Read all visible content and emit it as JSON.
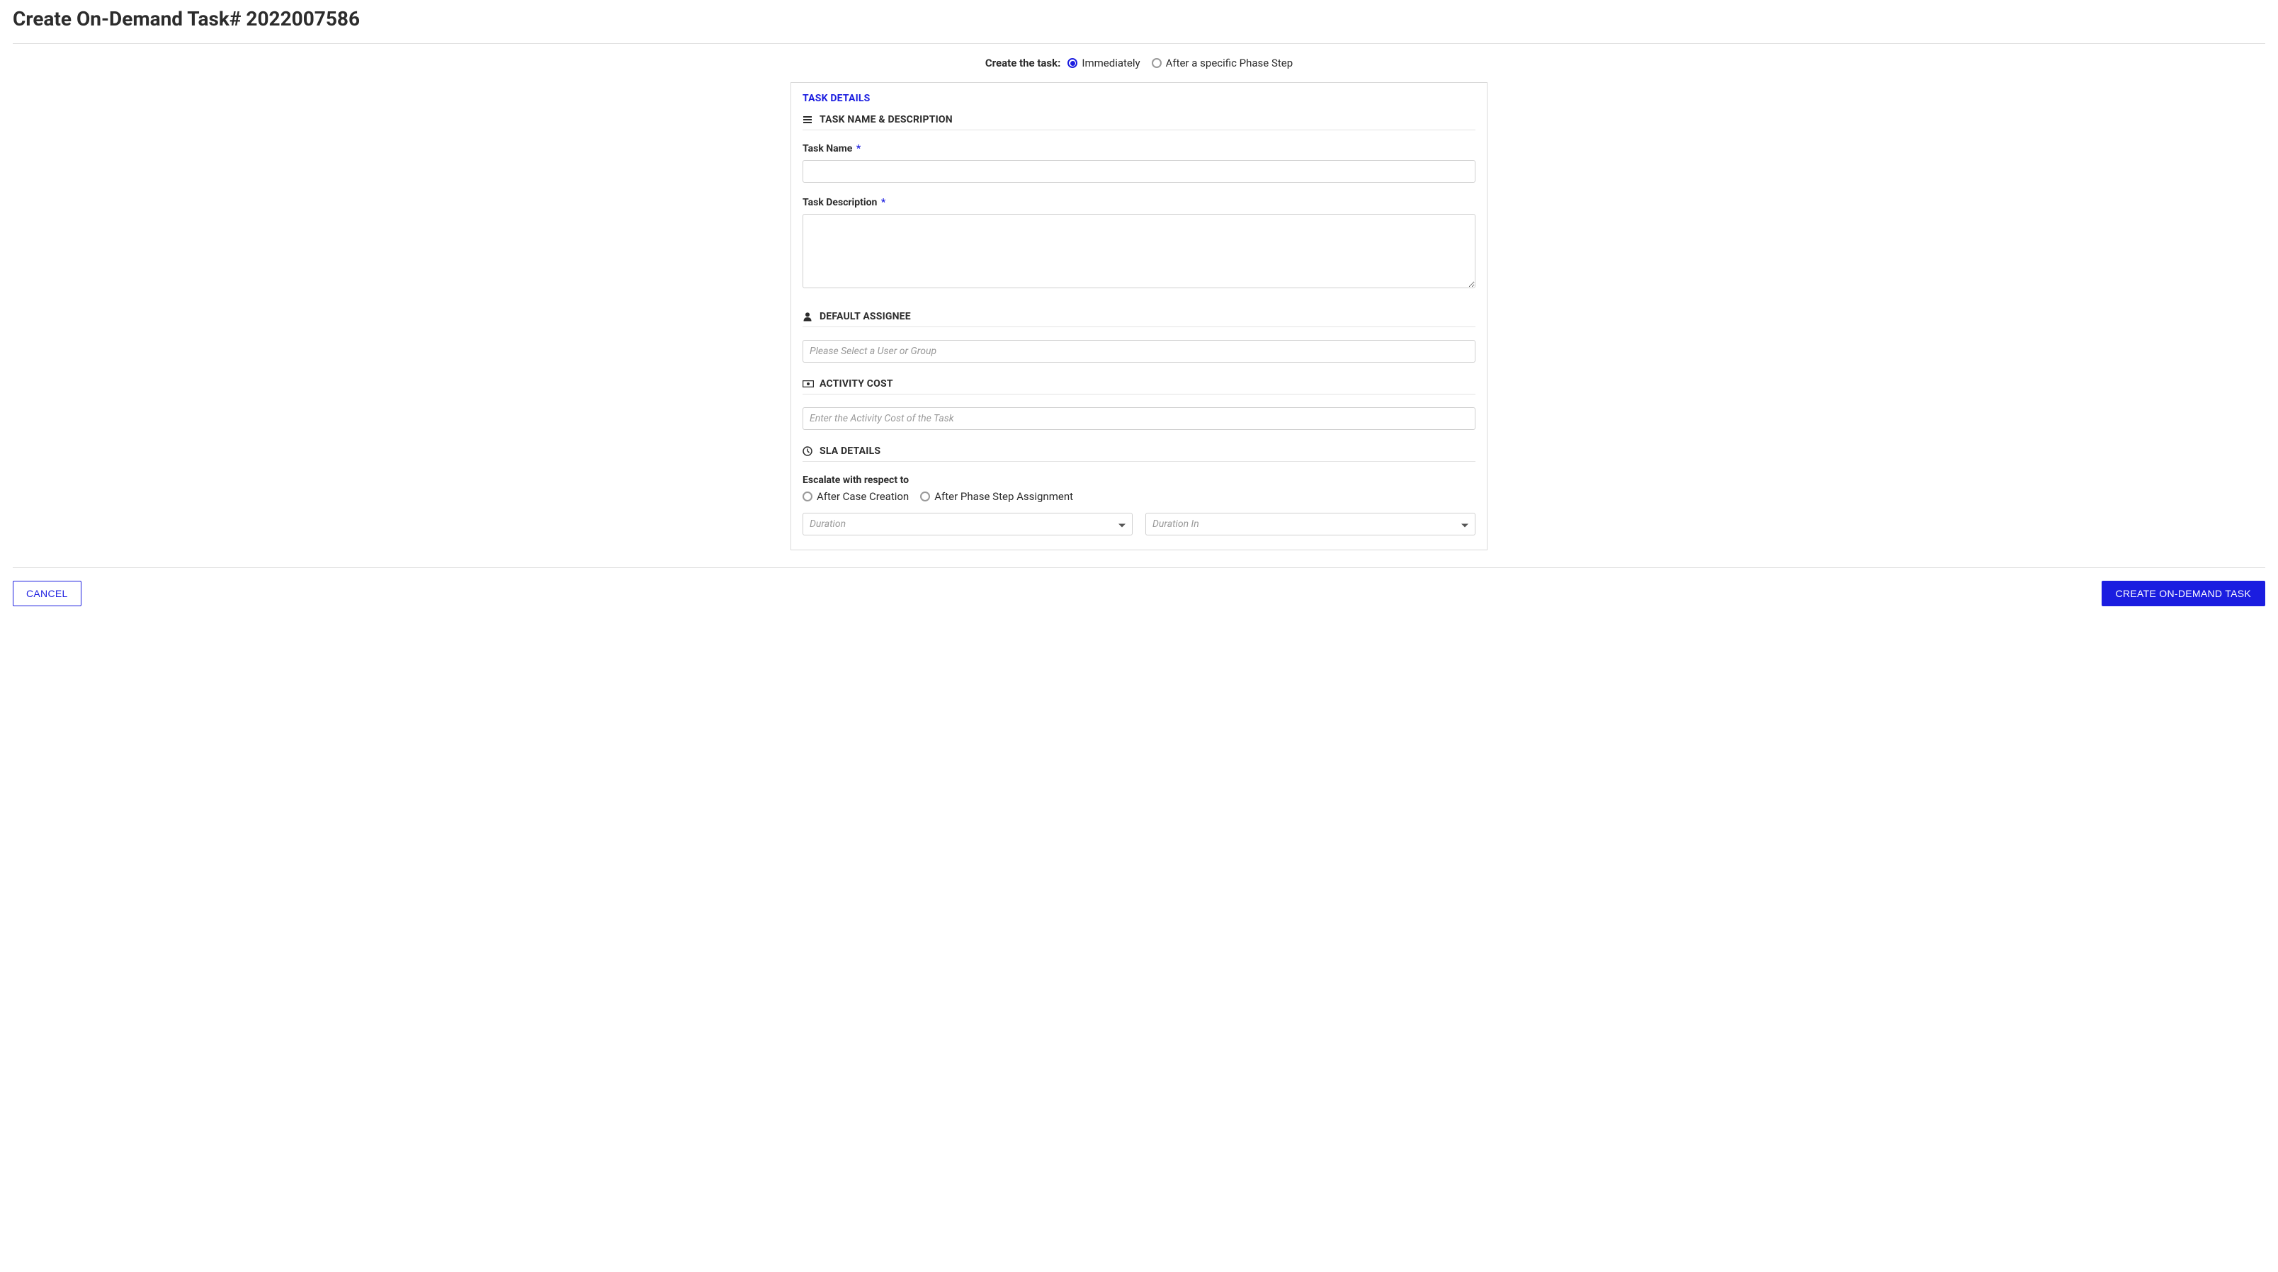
{
  "page": {
    "title": "Create On-Demand Task# 2022007586"
  },
  "createTask": {
    "label": "Create the task:",
    "options": {
      "immediately": "Immediately",
      "afterPhase": "After a specific Phase Step"
    },
    "selected": "immediately"
  },
  "panel": {
    "title": "TASK DETAILS",
    "sections": {
      "nameDesc": {
        "header": "TASK NAME & DESCRIPTION",
        "taskName": {
          "label": "Task Name",
          "required": "*",
          "value": ""
        },
        "taskDescription": {
          "label": "Task Description",
          "required": "*",
          "value": ""
        }
      },
      "assignee": {
        "header": "DEFAULT ASSIGNEE",
        "placeholder": "Please Select a User or Group",
        "value": ""
      },
      "activityCost": {
        "header": "ACTIVITY COST",
        "placeholder": "Enter the Activity Cost of the Task",
        "value": ""
      },
      "sla": {
        "header": "SLA DETAILS",
        "escalateLabel": "Escalate with respect to",
        "options": {
          "afterCase": "After Case Creation",
          "afterPhase": "After Phase Step Assignment"
        },
        "duration": {
          "placeholder": "Duration"
        },
        "durationIn": {
          "placeholder": "Duration In"
        }
      }
    }
  },
  "footer": {
    "cancel": "CANCEL",
    "create": "CREATE ON-DEMAND TASK"
  }
}
